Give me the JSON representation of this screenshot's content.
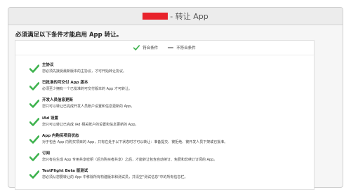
{
  "window": {
    "title_suffix": "- 转让 App"
  },
  "intro_text": "必须满足以下条件才能启用 App 转让。",
  "legend": {
    "met": "符合条件",
    "not_met": "不符合条件"
  },
  "colors": {
    "check_green": "#3fb34f",
    "redaction": "#e8222b"
  },
  "requirements": [
    {
      "title": "主协议",
      "description": "您必须先接受最新版本的主协议，才可开始转让协议。",
      "status": "met"
    },
    {
      "title": "已批准的可交付 App 版本",
      "description": "必须至少拥有一个已批准的可交付版本的 App 才可转让。",
      "status": "met"
    },
    {
      "title": "开发人员信息更新",
      "description": "您只可以转让已完成开发人员账户设置和信息更新的 App。",
      "status": "met"
    },
    {
      "title": "iAd 设置",
      "description": "您只可以转让已完成 iAd 相关账户的设置和信息更新的 App。",
      "status": "met"
    },
    {
      "title": "App 内购买项目状态",
      "description": "对于包含 App 内购买项目的 App，只有在处于以下状态时才可以转让：准备提交、被拒绝、被开发人员下架或已批准。",
      "status": "met"
    },
    {
      "title": "订阅",
      "description": "您只有在生成 App 专用共享密钥（后为购买者共享）之后，才能转让包含自动续订、免费和非续订订阅的 App。",
      "status": "met"
    },
    {
      "title": "TestFlight Beta 版测试",
      "description": "您必须从您要转让的 App 中移除所有构建版本和测试员，并清空\"测试信息\"中的所有信息栏。",
      "status": "met"
    }
  ]
}
